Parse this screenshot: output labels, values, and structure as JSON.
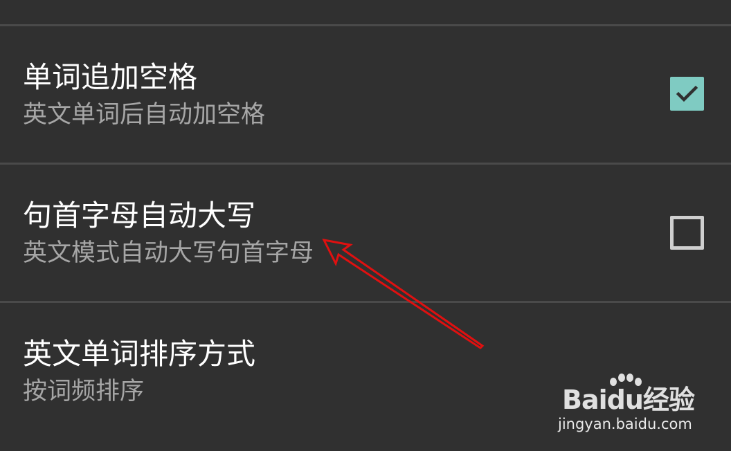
{
  "settings": [
    {
      "title": "单词追加空格",
      "subtitle": "英文单词后自动加空格",
      "checked": true
    },
    {
      "title": "句首字母自动大写",
      "subtitle": "英文模式自动大写句首字母",
      "checked": false
    },
    {
      "title": "英文单词排序方式",
      "subtitle": "按词频排序"
    }
  ],
  "watermark": {
    "logo": "Baidu经验",
    "url": "jingyan.baidu.com"
  },
  "colors": {
    "background": "#303030",
    "divider": "#4a4a4a",
    "title": "#ffffff",
    "subtitle": "#a6a6a6",
    "checkbox_checked": "#7fcbc2",
    "checkbox_unchecked_border": "#cfcfcf",
    "annotation_arrow": "#e01010"
  }
}
